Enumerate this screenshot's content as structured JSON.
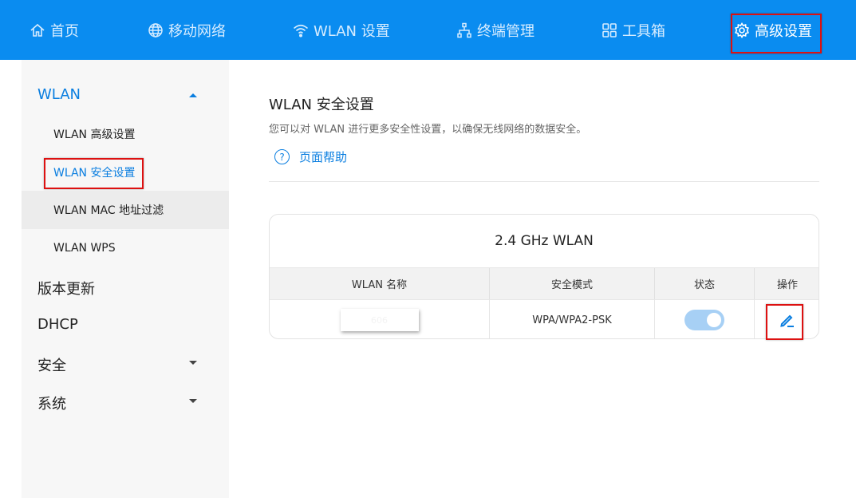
{
  "nav": {
    "items": [
      {
        "label": "首页",
        "icon": "home-icon"
      },
      {
        "label": "移动网络",
        "icon": "globe-icon"
      },
      {
        "label": "WLAN 设置",
        "icon": "wifi-icon"
      },
      {
        "label": "终端管理",
        "icon": "network-tree-icon"
      },
      {
        "label": "工具箱",
        "icon": "grid-icon"
      },
      {
        "label": "高级设置",
        "icon": "gear-icon"
      }
    ],
    "active": "高级设置"
  },
  "sidebar": {
    "groups": [
      {
        "label": "WLAN",
        "expanded": true
      },
      {
        "label": "版本更新"
      },
      {
        "label": "DHCP"
      },
      {
        "label": "安全",
        "expanded": false
      },
      {
        "label": "系统",
        "expanded": false
      }
    ],
    "wlan_items": [
      {
        "label": "WLAN 高级设置"
      },
      {
        "label": "WLAN 安全设置"
      },
      {
        "label": "WLAN MAC 地址过滤"
      },
      {
        "label": "WLAN WPS"
      }
    ]
  },
  "main": {
    "title": "WLAN 安全设置",
    "description": "您可以对 WLAN 进行更多安全性设置，以确保无线网络的数据安全。",
    "help_label": "页面帮助",
    "card": {
      "title": "2.4 GHz WLAN",
      "columns": [
        "WLAN 名称",
        "安全模式",
        "状态",
        "操作"
      ],
      "row": {
        "name": "606",
        "security_mode": "WPA/WPA2-PSK",
        "status_on": true
      }
    }
  },
  "colors": {
    "accent": "#0a8cf0",
    "link": "#0a7ee0",
    "highlight": "#dd1111"
  }
}
